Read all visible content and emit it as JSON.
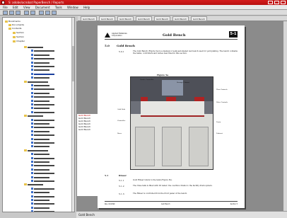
{
  "window": {
    "title": "S: adobe/acrobat  PaperBench / Reports"
  },
  "menubar": {
    "items": [
      "File",
      "Edit",
      "View",
      "Document",
      "Tools",
      "Window",
      "Help"
    ]
  },
  "tabs": [
    {
      "label": "Gold Bench"
    },
    {
      "label": "Gold Bench"
    },
    {
      "label": "Gold Bench"
    },
    {
      "label": "Gold Bench"
    },
    {
      "label": "Gold Bench"
    },
    {
      "label": "Gold Bench"
    },
    {
      "label": "Gold Bench"
    }
  ],
  "tree": {
    "rows": [
      {
        "label": "Bookmarks",
        "depth": 0,
        "kind": "folder"
      },
      {
        "label": "Documents",
        "depth": 1,
        "kind": "folder"
      },
      {
        "label": "Contents",
        "depth": 1,
        "kind": "folder"
      },
      {
        "label": "Section",
        "depth": 2,
        "kind": "folder"
      },
      {
        "label": "Section",
        "depth": 2,
        "kind": "folder"
      },
      {
        "label": "Chapter",
        "depth": 2,
        "kind": "folder"
      }
    ]
  },
  "left_list": {
    "items": [
      "Gold Bench",
      "Gold Bench",
      "Gold Bench",
      "Gold Bench",
      "Gold Bench",
      "Gold Bench"
    ]
  },
  "document": {
    "logo_text": "Applied Materials Corporation",
    "header_title": "Gold Bench",
    "page_number": "5-1",
    "page_sub": "",
    "section_number": "5.0",
    "section_title": "Gold Bench",
    "para1_number": "5.0.1",
    "para1_text": "The Gold Bench (Figure 5a) is a manual or semi-automated wet bench used for gold plating. The bench contains the tanks, controllers and valves described in this section.",
    "figure_label": "Figure 5a",
    "callouts": [
      "Nozzle Controller",
      "Storage Cabinet",
      "Flow Controls",
      "Valve Controls",
      "Gold Bath",
      "Controller",
      "Rinse",
      "Drain",
      "Exhaust"
    ],
    "sub_number": "5.1",
    "sub_title": "Rinser",
    "para2_number": "5.1.1",
    "para2_text": "Gold Rinser refers to the tank (Figure 5b).",
    "para3_number": "5.1.2",
    "para3_text": "The rinse tank is filled with DI water; the overflow drains to the facility drain system.",
    "para4_number": "5.1.3",
    "para4_text": "The Rinser is controlled from the front panel of the bench.",
    "footer_left": "Rev. 10/1999",
    "footer_mid": "Gold Bench",
    "footer_right": "Section 5"
  },
  "statusbar": {
    "text": "Gold Bench"
  }
}
